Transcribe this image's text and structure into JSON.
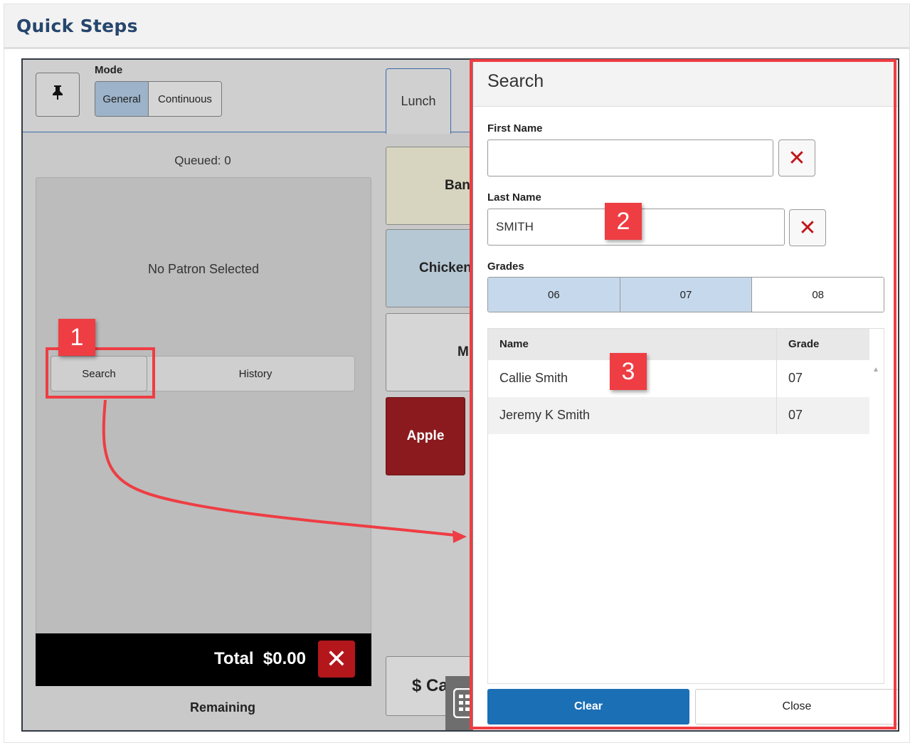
{
  "doc": {
    "title": "Quick Steps"
  },
  "toolbar": {
    "mode_label": "Mode",
    "modes": [
      "General",
      "Continuous"
    ],
    "selected_mode": "General"
  },
  "tabs": {
    "lunch": "Lunch"
  },
  "patron": {
    "queued": "Queued: 0",
    "empty_text": "No Patron Selected",
    "search_button": "Search",
    "history_button": "History",
    "total_text": "Total  $0.00",
    "remaining_label": "Remaining"
  },
  "items": {
    "banana": "Banana",
    "chicken": "Chicken",
    "milk": "Milk",
    "apple": "Apple",
    "cash": "$ Cash"
  },
  "search": {
    "title": "Search",
    "first_name_label": "First Name",
    "first_name_value": "",
    "last_name_label": "Last Name",
    "last_name_value": "SMITH",
    "grades_label": "Grades",
    "grades": [
      {
        "label": "06",
        "selected": true
      },
      {
        "label": "07",
        "selected": true
      },
      {
        "label": "08",
        "selected": false
      }
    ],
    "columns": {
      "name": "Name",
      "grade": "Grade"
    },
    "results": [
      {
        "name": "Callie Smith",
        "grade": "07"
      },
      {
        "name": "Jeremy K Smith",
        "grade": "07"
      }
    ],
    "clear_button": "Clear",
    "close_button": "Close"
  },
  "annotations": {
    "badge1": "1",
    "badge2": "2",
    "badge3": "3",
    "color": "#ee3d43"
  },
  "colors": {
    "accent_blue": "#1a6fb5",
    "delete_red": "#b3161b",
    "selected_grade": "#c6d9ec",
    "title_navy": "#26466d"
  }
}
